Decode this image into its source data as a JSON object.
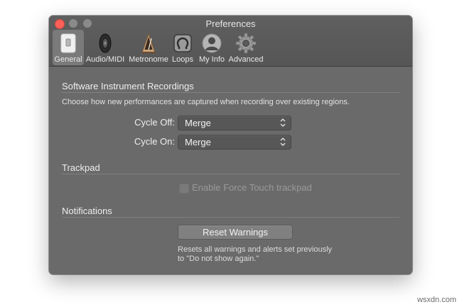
{
  "window": {
    "title": "Preferences",
    "toolbar": [
      {
        "label": "General",
        "icon": "general-switch-icon",
        "selected": true
      },
      {
        "label": "Audio/MIDI",
        "icon": "speaker-icon",
        "selected": false
      },
      {
        "label": "Metronome",
        "icon": "metronome-icon",
        "selected": false
      },
      {
        "label": "Loops",
        "icon": "loops-icon",
        "selected": false
      },
      {
        "label": "My Info",
        "icon": "user-silhouette-icon",
        "selected": false
      },
      {
        "label": "Advanced",
        "icon": "gear-icon",
        "selected": false
      }
    ]
  },
  "recordings": {
    "title": "Software Instrument Recordings",
    "description": "Choose how new performances are captured when recording over existing regions.",
    "cycle_off": {
      "label": "Cycle Off:",
      "value": "Merge"
    },
    "cycle_on": {
      "label": "Cycle On:",
      "value": "Merge"
    }
  },
  "trackpad": {
    "title": "Trackpad",
    "force_touch": {
      "label": "Enable Force Touch trackpad",
      "checked": false,
      "enabled": false
    }
  },
  "notifications": {
    "title": "Notifications",
    "reset_button": "Reset Warnings",
    "note_line1": "Resets all warnings and alerts set previously",
    "note_line2": "to \"Do not show again.\""
  },
  "watermark": "wsxdn.com",
  "colors": {
    "window_bg": "#6a6a6a",
    "titlebar_bg": "#5a5a5a",
    "close_button": "#fe5f57",
    "selected_tab": "#7a7a7a"
  }
}
